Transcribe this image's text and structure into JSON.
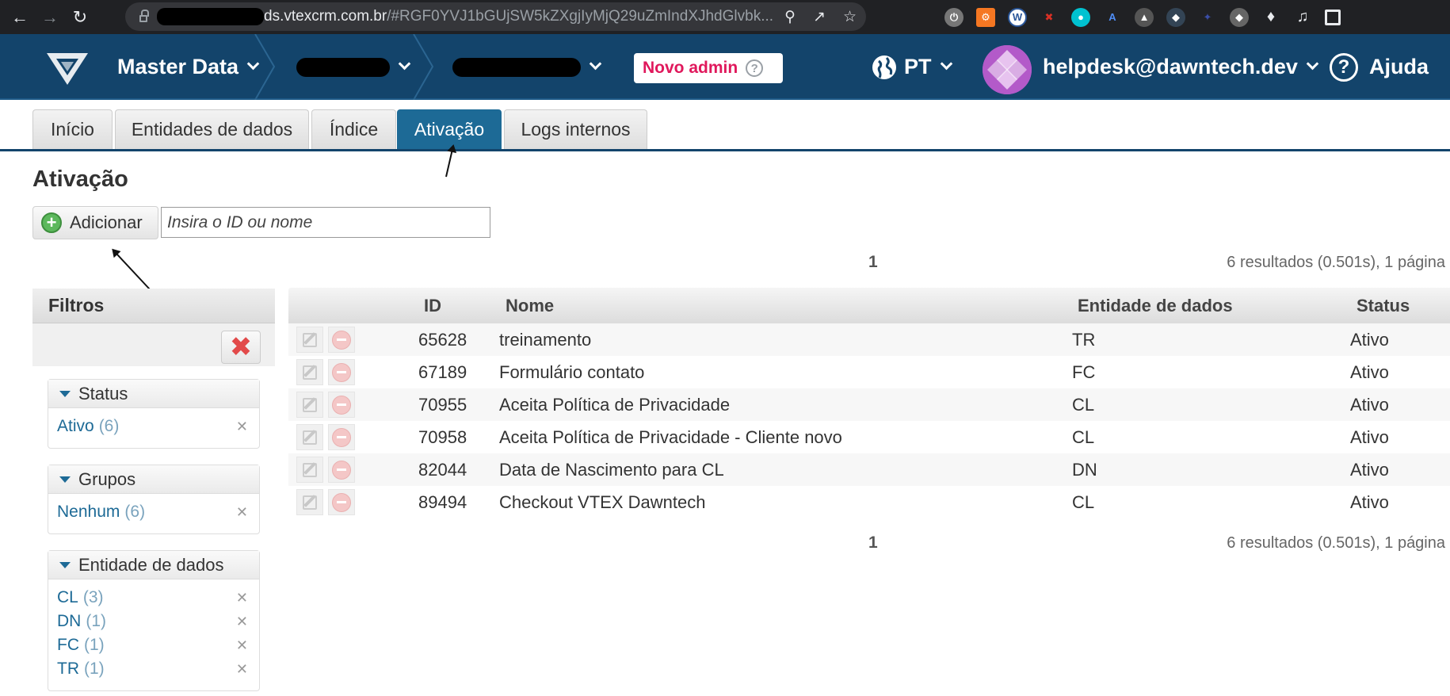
{
  "browser": {
    "url_domain": "ds.vtexcrm.com.br",
    "url_rest": "/#RGF0YVJ1bGUjSW5kZXgjIyMjQ29uZmIndXJhdGlvbk..."
  },
  "header": {
    "app_title": "Master Data",
    "novo_admin": "Novo admin",
    "language": "PT",
    "user_email": "helpdesk@dawntech.dev",
    "help_label": "Ajuda"
  },
  "tabs": [
    {
      "label": "Início"
    },
    {
      "label": "Entidades de dados"
    },
    {
      "label": "Índice"
    },
    {
      "label": "Ativação"
    },
    {
      "label": "Logs internos"
    }
  ],
  "page": {
    "title": "Ativação",
    "add_label": "Adicionar",
    "search_placeholder": "Insira o ID ou nome",
    "page_number": "1",
    "results_text": "6 resultados (0.501s), 1 página"
  },
  "sidebar": {
    "title": "Filtros",
    "groups": [
      {
        "title": "Status",
        "options": [
          {
            "label": "Ativo",
            "count": "(6)"
          }
        ]
      },
      {
        "title": "Grupos",
        "options": [
          {
            "label": "Nenhum",
            "count": "(6)"
          }
        ]
      },
      {
        "title": "Entidade de dados",
        "options": [
          {
            "label": "CL",
            "count": "(3)"
          },
          {
            "label": "DN",
            "count": "(1)"
          },
          {
            "label": "FC",
            "count": "(1)"
          },
          {
            "label": "TR",
            "count": "(1)"
          }
        ]
      }
    ]
  },
  "table": {
    "columns": [
      "ID",
      "Nome",
      "Entidade de dados",
      "Status"
    ],
    "rows": [
      {
        "id": "65628",
        "name": "treinamento",
        "entity": "TR",
        "status": "Ativo"
      },
      {
        "id": "67189",
        "name": "Formulário contato",
        "entity": "FC",
        "status": "Ativo"
      },
      {
        "id": "70955",
        "name": "Aceita Política de Privacidade",
        "entity": "CL",
        "status": "Ativo"
      },
      {
        "id": "70958",
        "name": "Aceita Política de Privacidade - Cliente novo",
        "entity": "CL",
        "status": "Ativo"
      },
      {
        "id": "82044",
        "name": "Data de Nascimento para CL",
        "entity": "DN",
        "status": "Ativo"
      },
      {
        "id": "89494",
        "name": "Checkout VTEX Dawntech",
        "entity": "CL",
        "status": "Ativo"
      }
    ]
  },
  "colors": {
    "header_bg": "#13446b",
    "active_tab": "#1d6a96",
    "novo_admin_text": "#e0185c"
  }
}
